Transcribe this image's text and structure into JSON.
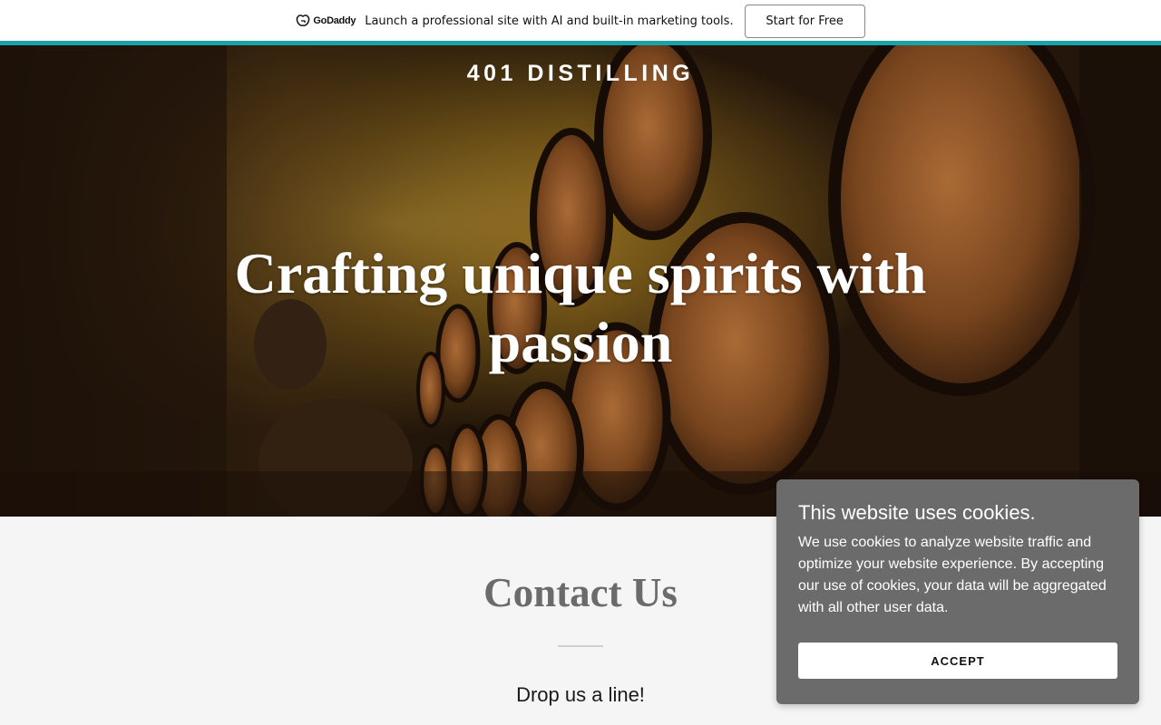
{
  "promo": {
    "logo_text": "GoDaddy",
    "message": "Launch a professional site with AI and built-in marketing tools.",
    "cta_label": "Start for Free",
    "accent_color": "#1ba3a8"
  },
  "hero": {
    "brand": "401 DISTILLING",
    "headline": "Crafting unique spirits with passion"
  },
  "contact": {
    "title": "Contact Us",
    "subtitle": "Drop us a line!"
  },
  "cookie_banner": {
    "title": "This website uses cookies.",
    "body": "We use cookies to analyze website traffic and optimize your website experience. By accepting our use of cookies, your data will be aggregated with all other user data.",
    "accept_label": "ACCEPT",
    "background_color": "#6b6b6b"
  }
}
